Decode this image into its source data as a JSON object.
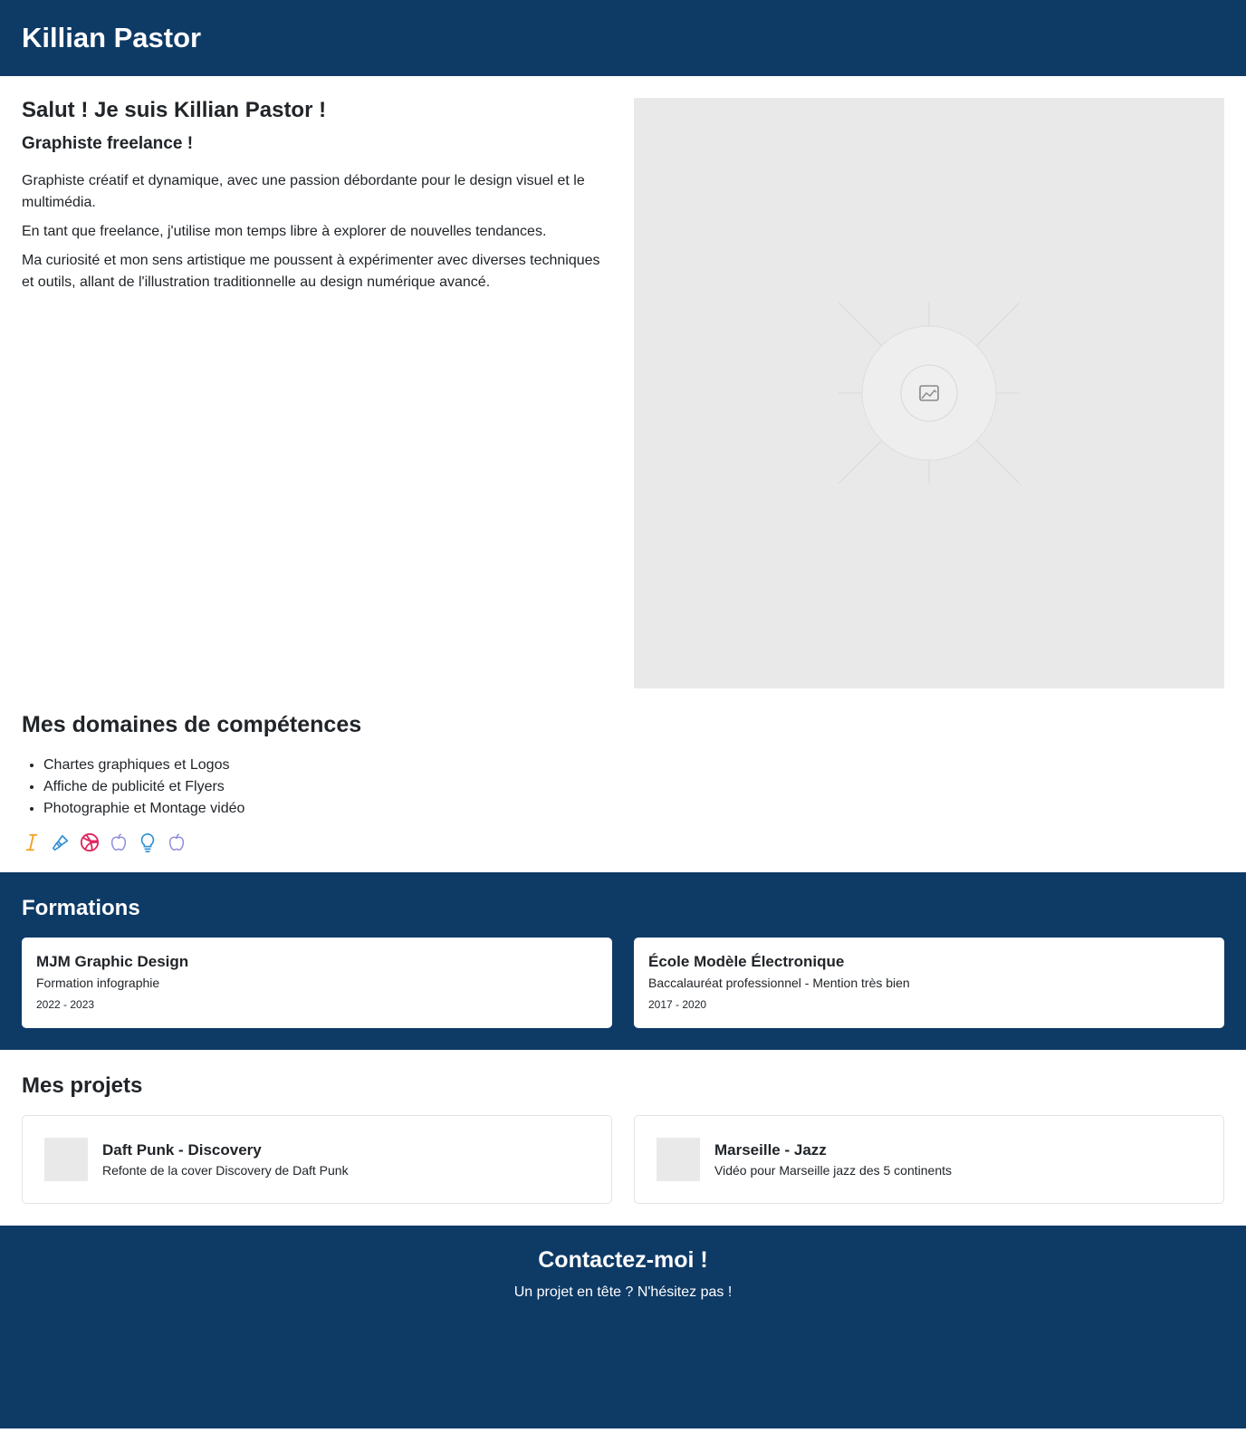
{
  "header": {
    "title": "Killian Pastor"
  },
  "hero": {
    "heading": "Salut ! Je suis Killian Pastor !",
    "subheading": "Graphiste freelance !",
    "paragraphs": [
      "Graphiste créatif et dynamique, avec une passion débordante pour le design visuel et le multimédia.",
      "En tant que freelance, j'utilise mon temps libre à explorer de nouvelles tendances.",
      "Ma curiosité et mon sens artistique me poussent à expérimenter avec diverses techniques et outils, allant de l'illustration traditionnelle au design numérique avancé."
    ],
    "image_icon": "image-placeholder-icon"
  },
  "skills": {
    "heading": "Mes domaines de compétences",
    "items": [
      "Chartes graphiques et Logos",
      "Affiche de publicité et Flyers",
      "Photographie et Montage vidéo"
    ],
    "icons": [
      {
        "name": "italic-icon",
        "color": "#f0a020"
      },
      {
        "name": "paintbrush-icon",
        "color": "#2d8fd5"
      },
      {
        "name": "dribbble-icon",
        "color": "#e0245e"
      },
      {
        "name": "apple-icon",
        "color": "#8e8ed8"
      },
      {
        "name": "lightbulb-icon",
        "color": "#2d8fd5"
      },
      {
        "name": "apple-icon",
        "color": "#8e8ed8"
      }
    ]
  },
  "formations": {
    "heading": "Formations",
    "items": [
      {
        "title": "MJM Graphic Design",
        "subtitle": "Formation infographie",
        "dates": "2022 - 2023"
      },
      {
        "title": "École Modèle Électronique",
        "subtitle": "Baccalauréat professionnel - Mention très bien",
        "dates": "2017 - 2020"
      }
    ]
  },
  "projects": {
    "heading": "Mes projets",
    "items": [
      {
        "title": "Daft Punk - Discovery",
        "subtitle": "Refonte de la cover Discovery de Daft Punk"
      },
      {
        "title": "Marseille - Jazz",
        "subtitle": "Vidéo pour Marseille jazz des 5 continents"
      }
    ]
  },
  "contact": {
    "heading": "Contactez-moi !",
    "subtitle": "Un projet en tête ? N'hésitez pas !"
  },
  "colors": {
    "primary": "#0e3a66",
    "placeholder": "#e9e9e9"
  }
}
